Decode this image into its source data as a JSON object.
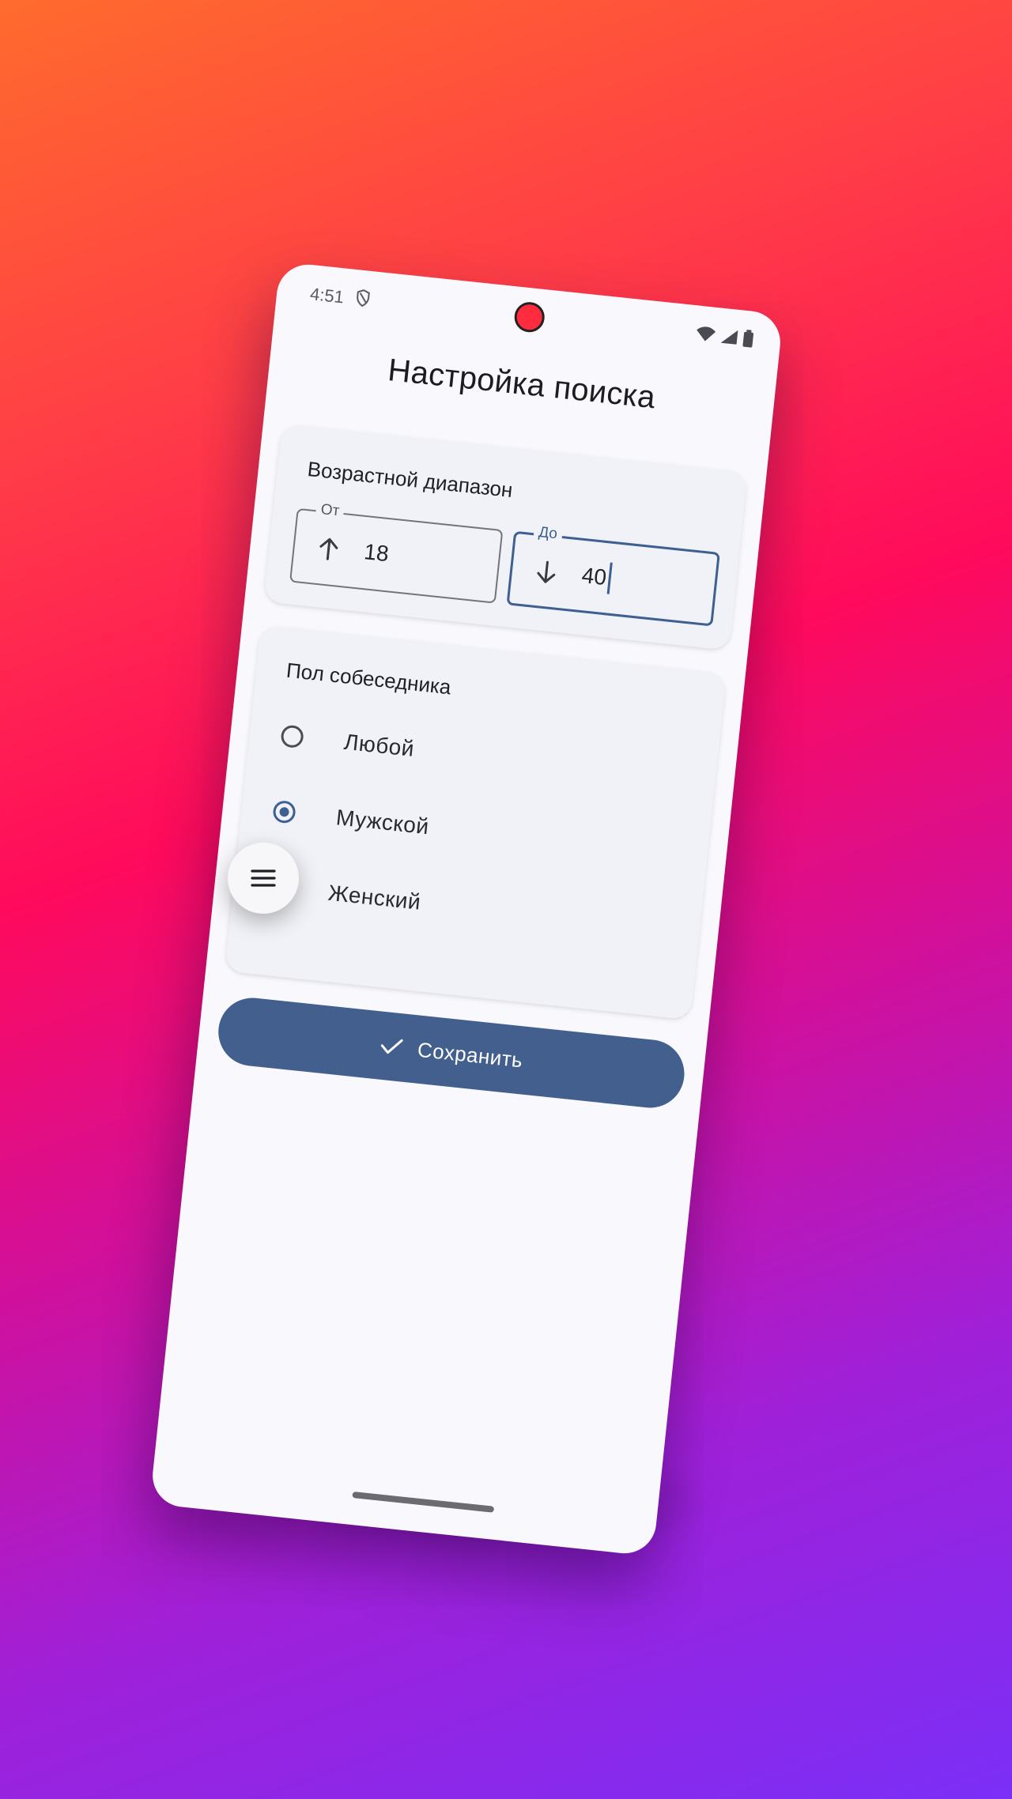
{
  "status_bar": {
    "time": "4:51"
  },
  "page": {
    "title": "Настройка поиска"
  },
  "age_range": {
    "title": "Возрастной диапазон",
    "from": {
      "label": "От",
      "value": "18",
      "icon": "arrow-up-icon"
    },
    "to": {
      "label": "До",
      "value": "40",
      "icon": "arrow-down-icon",
      "focused": true
    }
  },
  "gender": {
    "title": "Пол собеседника",
    "options": [
      {
        "label": "Любой",
        "selected": false
      },
      {
        "label": "Мужской",
        "selected": true
      },
      {
        "label": "Женский",
        "selected": false
      }
    ]
  },
  "actions": {
    "save_label": "Сохранить",
    "save_icon": "check-icon"
  },
  "floating_menu": {
    "icon": "menu-icon"
  },
  "colors": {
    "accent": "#435f8e",
    "card_bg": "#f1f2f7",
    "screen_bg": "#f8f8fd",
    "camera": "#ff2b3f"
  }
}
